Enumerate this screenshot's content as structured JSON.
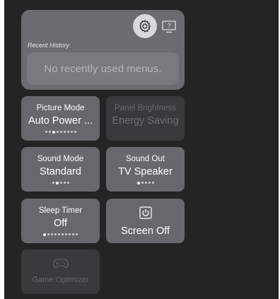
{
  "recent_history": {
    "label": "Recent History",
    "empty_text": "No recently used menus."
  },
  "header_icons": {
    "settings": "gear-icon",
    "help": "help-tv-icon"
  },
  "tiles": {
    "picture_mode": {
      "title": "Picture Mode",
      "value": "Auto Power ...",
      "options_count": 9,
      "selected_index": 2
    },
    "panel_brightness": {
      "title": "Panel Brightness",
      "value": "Energy Saving",
      "enabled": false
    },
    "sound_mode": {
      "title": "Sound Mode",
      "value": "Standard",
      "options_count": 5,
      "selected_index": 1
    },
    "sound_out": {
      "title": "Sound Out",
      "value": "TV Speaker",
      "options_count": 5,
      "selected_index": 0
    },
    "sleep_timer": {
      "title": "Sleep Timer",
      "value": "Off",
      "options_count": 10,
      "selected_index": 0
    },
    "screen_off": {
      "label": "Screen Off",
      "icon": "power-icon"
    },
    "game_optimizer": {
      "label": "Game Optimizer",
      "icon": "gamepad-icon",
      "enabled": false
    }
  },
  "colors": {
    "background": "#242425",
    "tile": "#68686c",
    "tile_disabled": "#3a3a3c",
    "history_panel": "#6c6c70"
  }
}
